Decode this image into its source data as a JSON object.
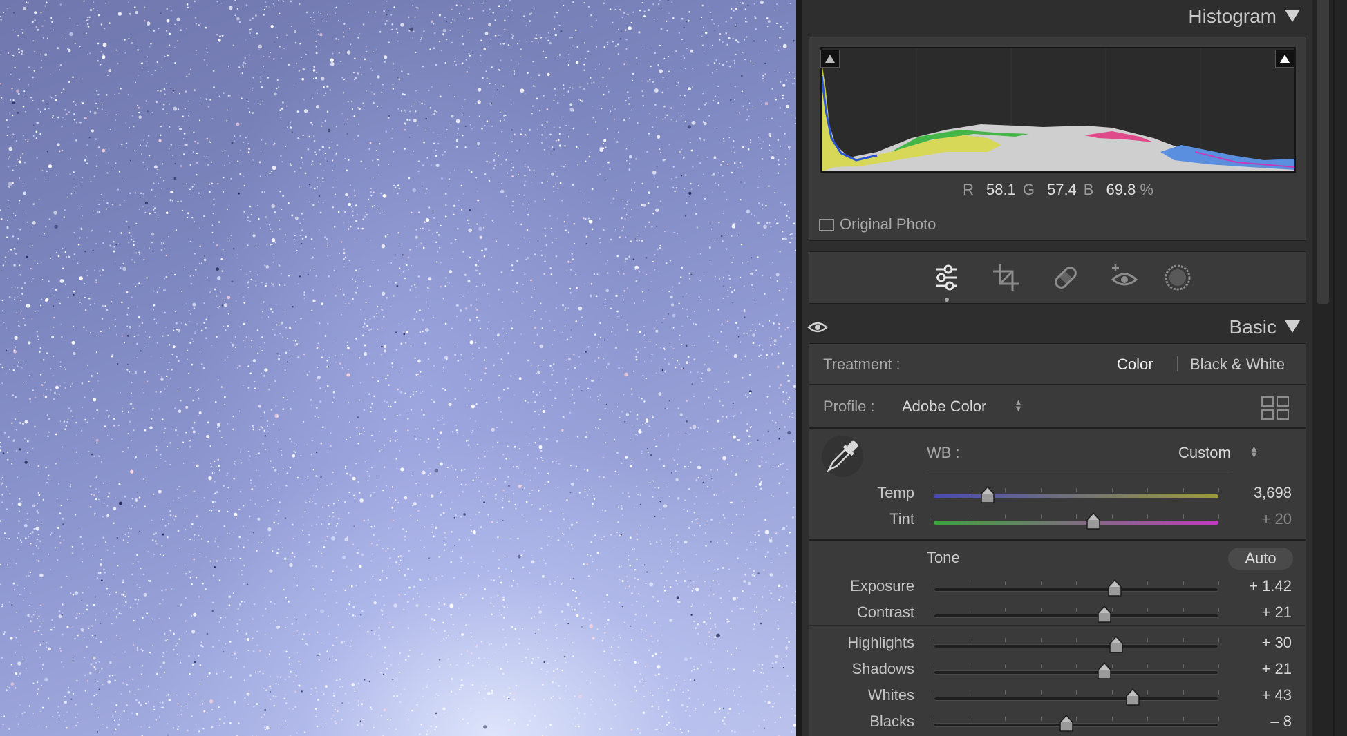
{
  "histogram": {
    "title": "Histogram",
    "readout": {
      "r_label": "R",
      "r": "58.1",
      "g_label": "G",
      "g": "57.4",
      "b_label": "B",
      "b": "69.8",
      "unit": "%"
    },
    "original_photo_label": "Original Photo"
  },
  "tools": [
    {
      "name": "edit-sliders-icon",
      "active": true
    },
    {
      "name": "crop-icon",
      "active": false
    },
    {
      "name": "healing-bandage-icon",
      "active": false
    },
    {
      "name": "red-eye-icon",
      "active": false
    },
    {
      "name": "masking-icon",
      "active": false
    }
  ],
  "basic": {
    "title": "Basic",
    "treatment_label": "Treatment :",
    "treatment_options": [
      "Color",
      "Black & White"
    ],
    "profile_label": "Profile :",
    "profile_value": "Adobe Color",
    "wb_label": "WB :",
    "wb_value": "Custom",
    "tone_label": "Tone",
    "auto_label": "Auto"
  },
  "sliders": {
    "temp": {
      "label": "Temp",
      "value": "3,698",
      "position": 0.19
    },
    "tint": {
      "label": "Tint",
      "value": "+ 20",
      "position": 0.56
    },
    "exposure": {
      "label": "Exposure",
      "value": "+ 1.42",
      "position": 0.635
    },
    "contrast": {
      "label": "Contrast",
      "value": "+ 21",
      "position": 0.6
    },
    "highlights": {
      "label": "Highlights",
      "value": "+ 30",
      "position": 0.64
    },
    "shadows": {
      "label": "Shadows",
      "value": "+ 21",
      "position": 0.6
    },
    "whites": {
      "label": "Whites",
      "value": "+ 43",
      "position": 0.7
    },
    "blacks": {
      "label": "Blacks",
      "value": "– 8",
      "position": 0.465
    }
  },
  "colors": {
    "panel_bg": "#3a3a3a",
    "sky": "#8e97d0"
  }
}
